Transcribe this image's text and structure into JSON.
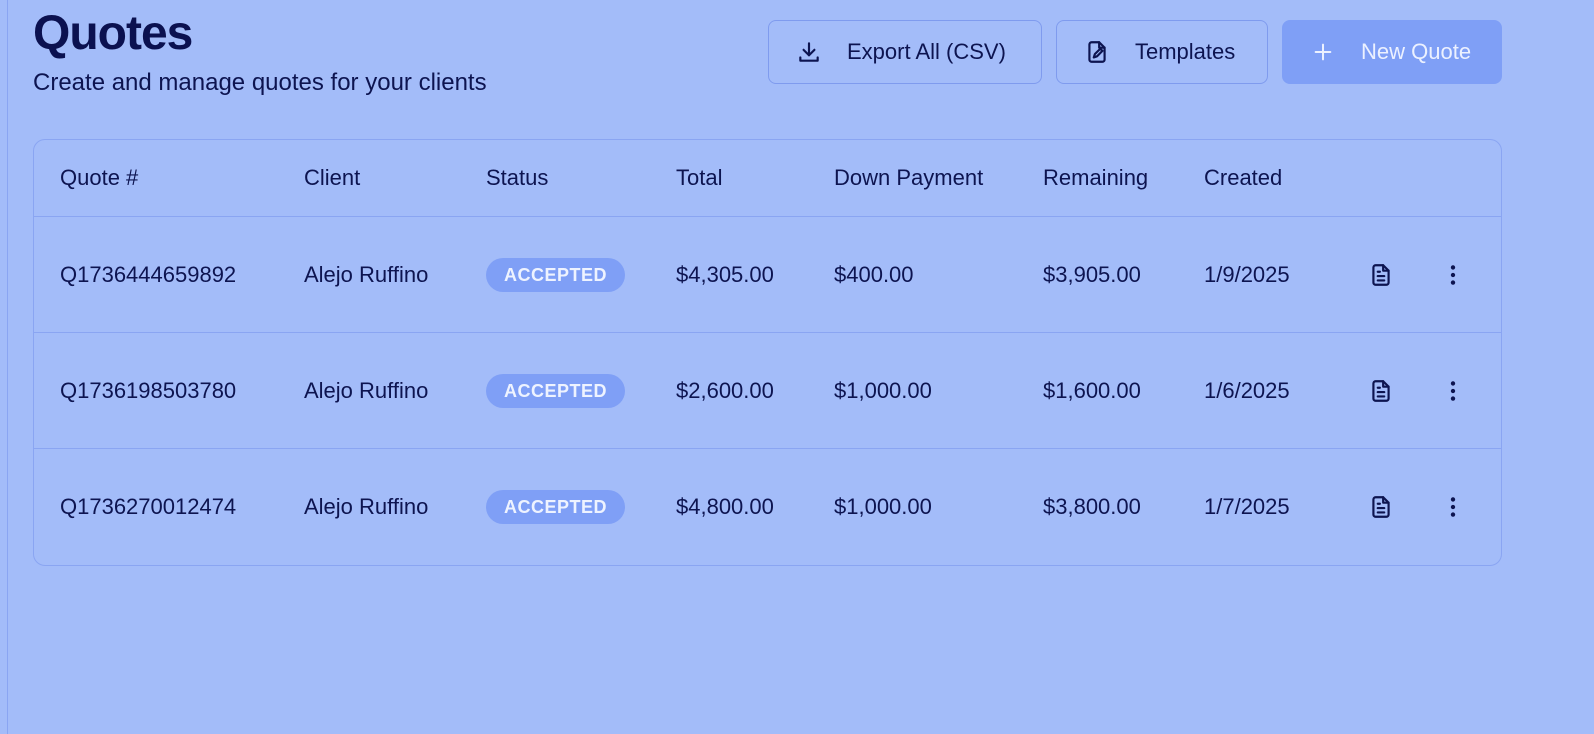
{
  "header": {
    "title": "Quotes",
    "subtitle": "Create and manage quotes for your clients"
  },
  "actions": {
    "export_label": "Export All (CSV)",
    "export_icon": "download-icon",
    "templates_label": "Templates",
    "templates_icon": "file-edit-icon",
    "new_label": "New Quote",
    "new_icon": "plus-icon"
  },
  "table": {
    "columns": {
      "quote": "Quote #",
      "client": "Client",
      "status": "Status",
      "total": "Total",
      "down": "Down Payment",
      "remaining": "Remaining",
      "created": "Created"
    },
    "rows": [
      {
        "quote": "Q1736444659892",
        "client": "Alejo Ruffino",
        "status": "ACCEPTED",
        "total": "$4,305.00",
        "down": "$400.00",
        "remaining": "$3,905.00",
        "created": "1/9/2025"
      },
      {
        "quote": "Q1736198503780",
        "client": "Alejo Ruffino",
        "status": "ACCEPTED",
        "total": "$2,600.00",
        "down": "$1,000.00",
        "remaining": "$1,600.00",
        "created": "1/6/2025"
      },
      {
        "quote": "Q1736270012474",
        "client": "Alejo Ruffino",
        "status": "ACCEPTED",
        "total": "$4,800.00",
        "down": "$1,000.00",
        "remaining": "$3,800.00",
        "created": "1/7/2025"
      }
    ],
    "row_icons": [
      "document-icon",
      "more-vertical-icon"
    ]
  },
  "colors": {
    "background": "#a3bcf9",
    "text": "#0d1450",
    "accent": "#7f9ff6",
    "border": "#8aa5f2"
  }
}
